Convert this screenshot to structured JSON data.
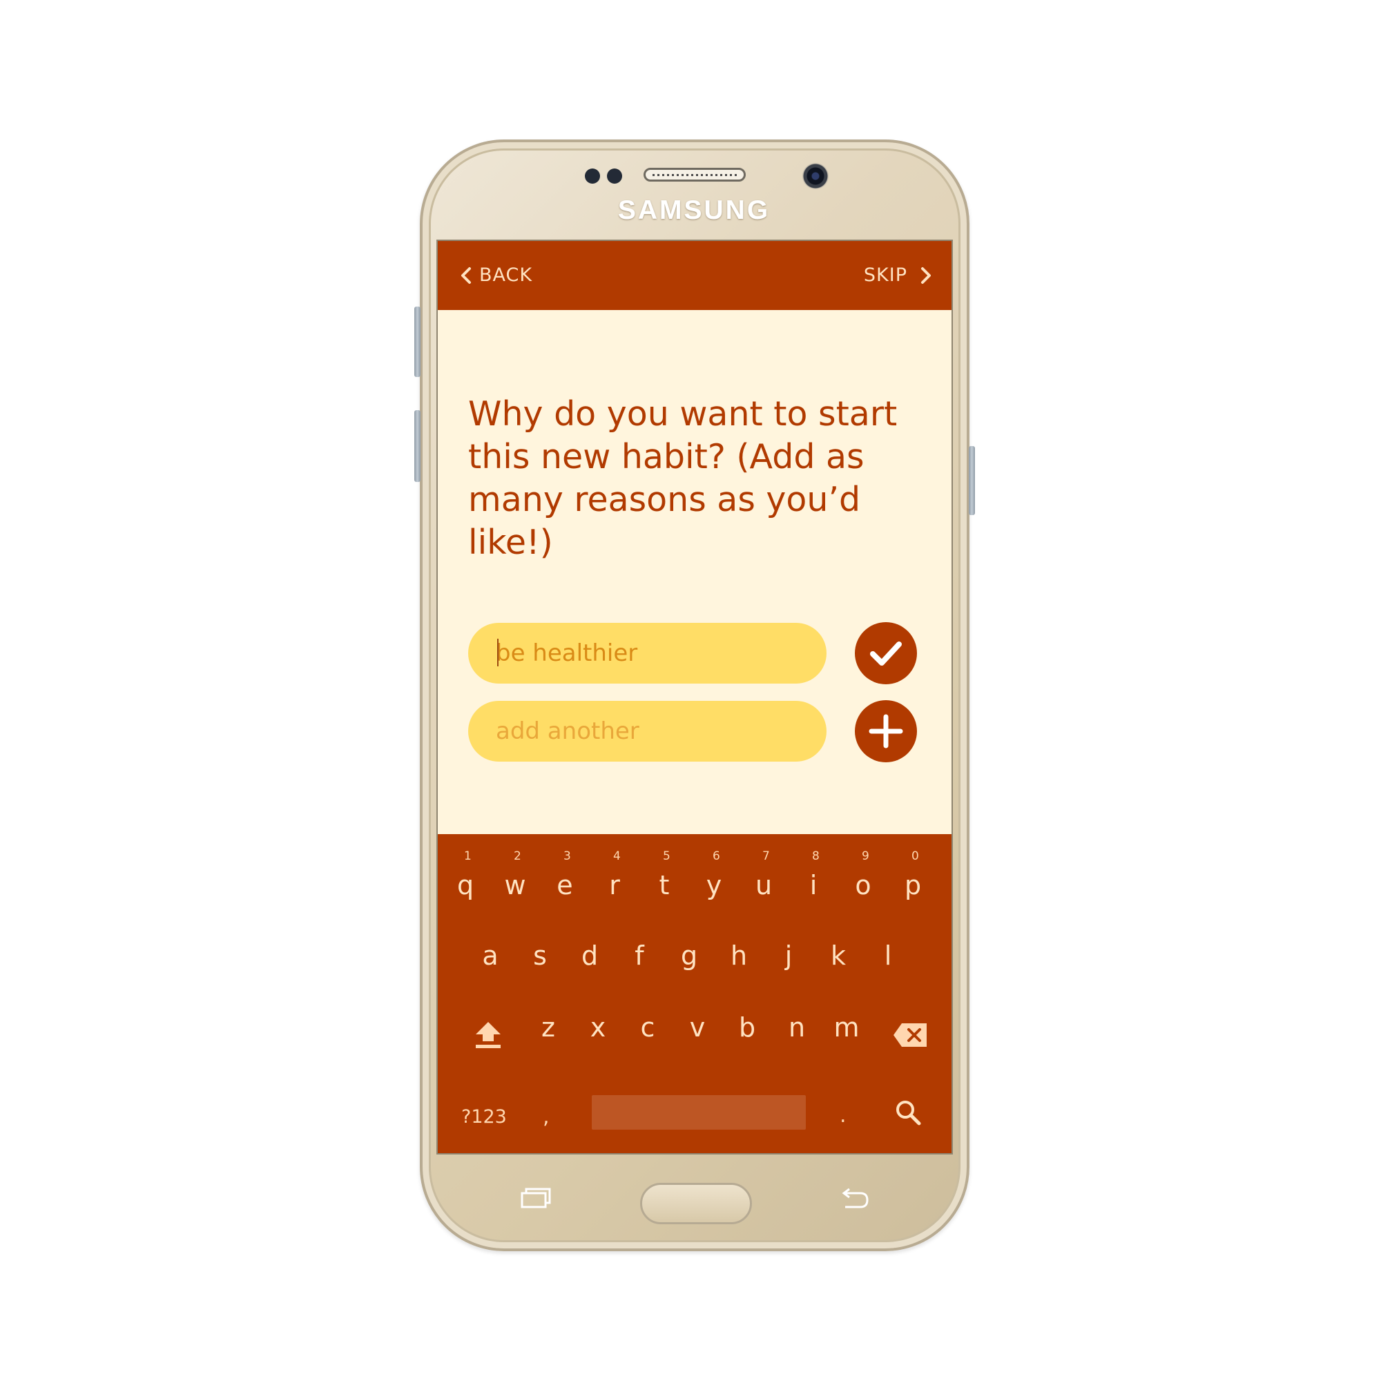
{
  "device": {
    "brand": "SAMSUNG"
  },
  "nav": {
    "back_label": "BACK",
    "skip_label": "SKIP"
  },
  "question": {
    "text": "Why do you want to start this new habit? (Add as many reasons as you’d like!)"
  },
  "reasons": {
    "first_value": "be healthier",
    "add_placeholder": "add another"
  },
  "icons": {
    "back": "chevron-left-icon",
    "skip": "chevron-right-icon",
    "confirm": "checkmark-icon",
    "add": "plus-icon",
    "shift": "shift-icon",
    "backspace": "backspace-icon",
    "search": "search-icon"
  },
  "keyboard": {
    "row1": [
      {
        "key": "q",
        "hint": "1"
      },
      {
        "key": "w",
        "hint": "2"
      },
      {
        "key": "e",
        "hint": "3"
      },
      {
        "key": "r",
        "hint": "4"
      },
      {
        "key": "t",
        "hint": "5"
      },
      {
        "key": "y",
        "hint": "6"
      },
      {
        "key": "u",
        "hint": "7"
      },
      {
        "key": "i",
        "hint": "8"
      },
      {
        "key": "o",
        "hint": "9"
      },
      {
        "key": "p",
        "hint": "0"
      }
    ],
    "row2": [
      "a",
      "s",
      "d",
      "f",
      "g",
      "h",
      "j",
      "k",
      "l"
    ],
    "row3": [
      "z",
      "x",
      "c",
      "v",
      "b",
      "n",
      "m"
    ],
    "symbols_label": "?123",
    "comma": ",",
    "period": "."
  },
  "colors": {
    "primary": "#b13a00",
    "background": "#fff5dd",
    "input_fill": "#ffdd66",
    "key_text": "#ffe3c2",
    "space_bar": "#bd5624",
    "phone_body": "#d9caa9"
  }
}
